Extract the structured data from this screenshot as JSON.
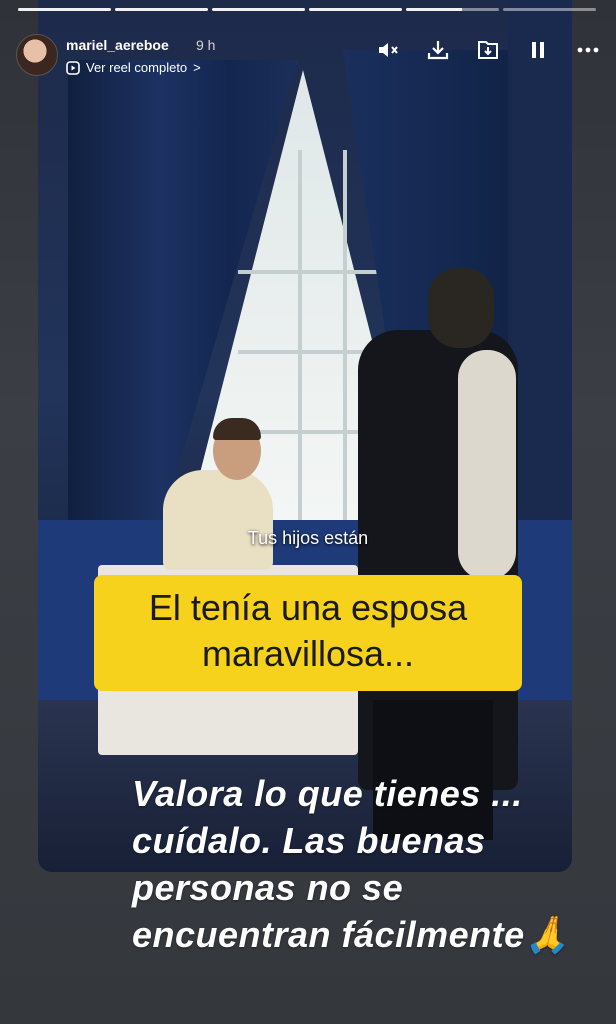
{
  "story": {
    "username": "mariel_aereboe",
    "time": "9 h",
    "reel_link": "Ver reel completo",
    "chevron": ">",
    "progress_segments": [
      1,
      1,
      1,
      1,
      0.6,
      0
    ],
    "icons": [
      "mute-icon",
      "download-icon",
      "save-icon",
      "pause-icon",
      "more-icon"
    ]
  },
  "video": {
    "subtitle": "Tus hijos están",
    "sticker_line1": "El tenía una esposa",
    "sticker_line2": "maravillosa..."
  },
  "overlay": {
    "text": "Valora lo que tienes ... cuídalo. Las buenas personas no se encuentran fácilmente",
    "emoji": "🙏"
  },
  "colors": {
    "sticker": "#f7d21c",
    "background": "#3a3d43"
  }
}
